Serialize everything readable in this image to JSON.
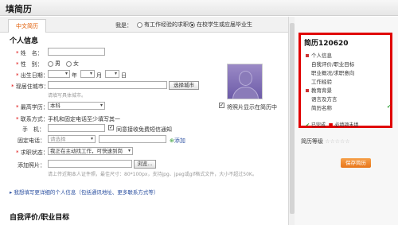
{
  "header": {
    "title": "填简历"
  },
  "tabs": [
    {
      "label": "中文简历"
    }
  ],
  "identity": {
    "prompt": "我是：",
    "option1": "有工作经验的求职者",
    "option2": "在校学生或应届毕业生"
  },
  "personal": {
    "section_title": "个人信息",
    "name_label": "姓　名：",
    "gender_label": "性　别：",
    "gender_male": "男",
    "gender_female": "女",
    "birth_label": "出生日期：",
    "year_unit": "年",
    "month_unit": "月",
    "day_unit": "日",
    "city_label": "现居住城市：",
    "city_button": "选择城市",
    "city_hint": "请填写具体城市。",
    "edu_label": "最高学历：",
    "edu_value": "本科",
    "show_photo_label": "将照片显示在简历中",
    "contact_label": "联系方式：",
    "contact_note": "手机和固定电话至少填写其一",
    "mobile_label": "手　机：",
    "free_notice_label": "同意接收免费短信通知",
    "phone_label": "固定电话：",
    "phone_placeholder": "请选择",
    "add_label": "添加",
    "status_label": "求职状态：",
    "status_value": "我正在主动找工作，可快速到岗",
    "photo_label": "添加照片：",
    "browse_label": "浏览...",
    "photo_hint": "请上传近期本人证件照，最佳尺寸：80*100px，支持jpg、jpeg或gif格式文件，大小不超过50K。"
  },
  "more_link": "我想填写更详细的个人信息（包括通讯地址、更多联系方式等）",
  "next_section": "自我评价/职业目标",
  "sidebar": {
    "resume_title": "简历120620",
    "items": [
      {
        "label": "个人信息",
        "required": true,
        "done": false
      },
      {
        "label": "自我评价/职业目标",
        "required": false,
        "done": false
      },
      {
        "label": "职业概况/求职意向",
        "required": false,
        "done": false
      },
      {
        "label": "工作经验",
        "required": false,
        "done": false
      },
      {
        "label": "教育背景",
        "required": true,
        "done": false
      },
      {
        "label": "语言及方言",
        "required": false,
        "done": false
      },
      {
        "label": "简历名称",
        "required": false,
        "done": true
      }
    ],
    "legend_done": "已完成",
    "legend_required": "必填项未填",
    "level_label": "简历等级",
    "level_stars": "☆☆☆☆☆",
    "save_button": "保存简历"
  },
  "colors": {
    "accent": "#e05a00",
    "highlight_border": "#e00000",
    "save_button": "#e8761a"
  }
}
